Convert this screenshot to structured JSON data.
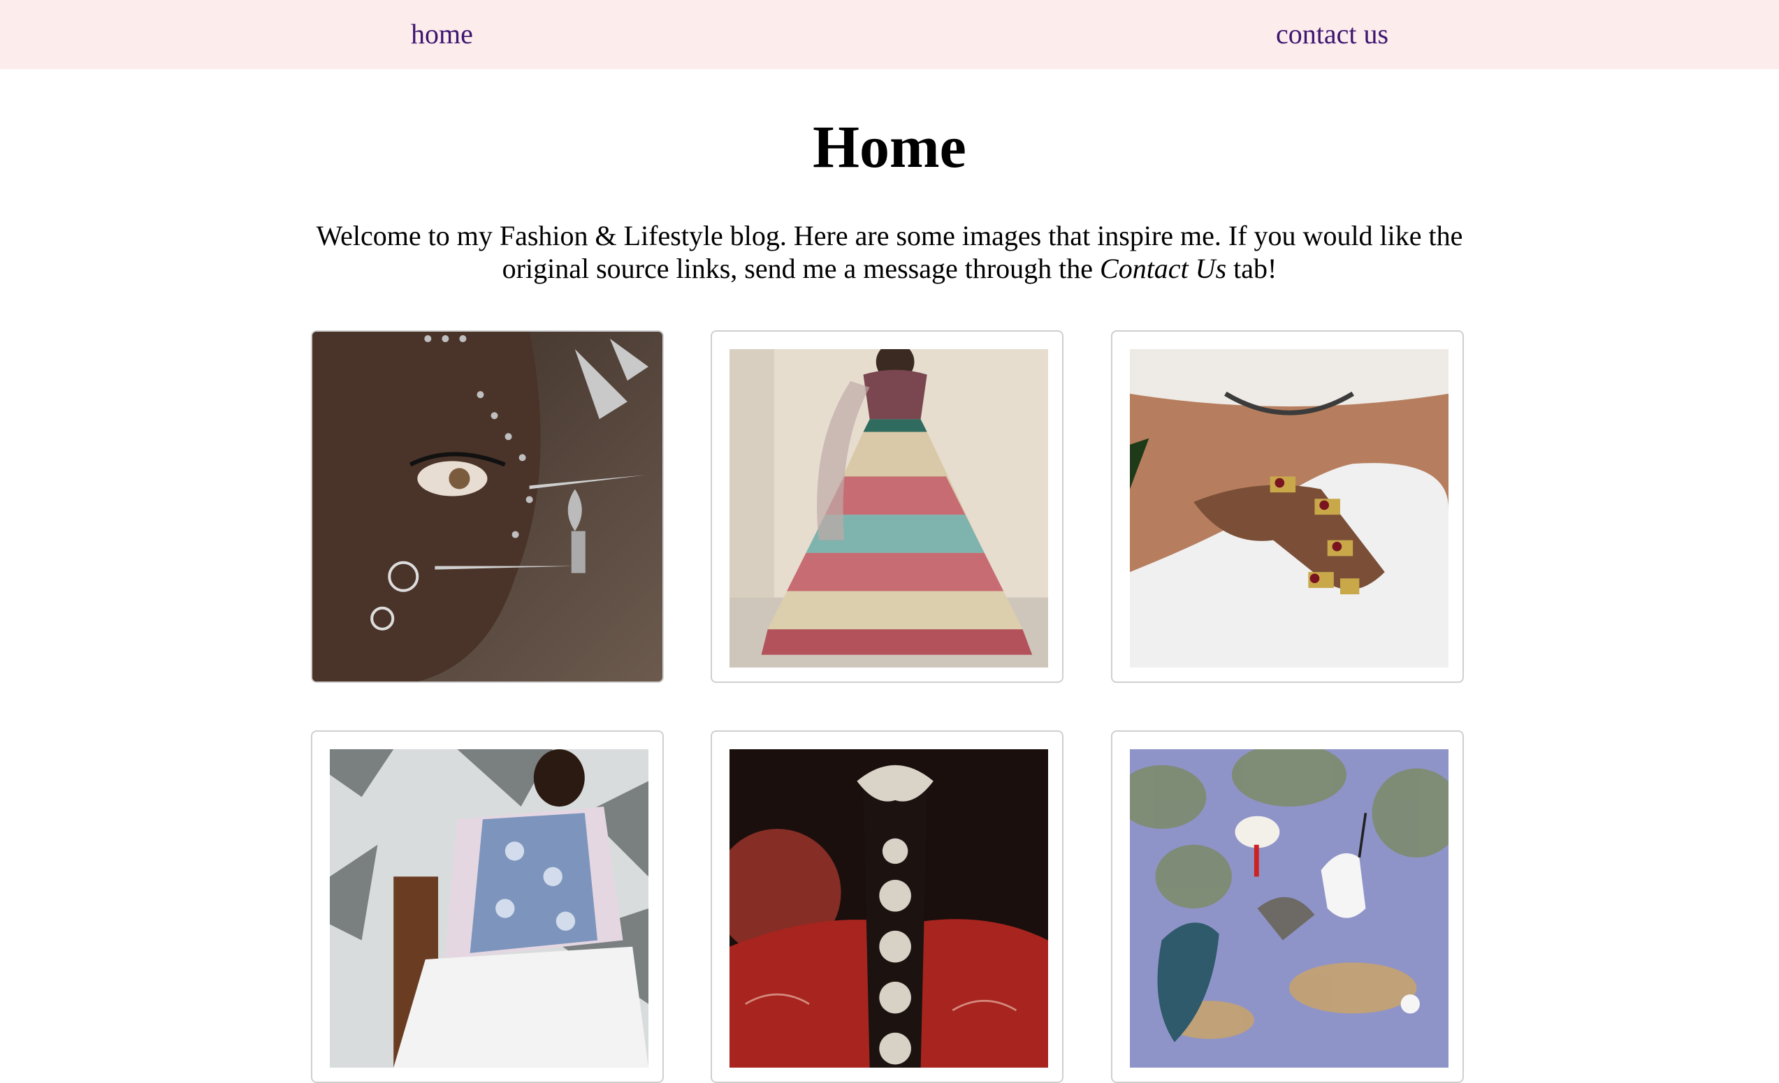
{
  "nav": {
    "home_label": "home",
    "contact_label": "contact us",
    "link_color": "#3d1670",
    "background": "#fcecec"
  },
  "main": {
    "title": "Home",
    "intro_before": "Welcome to my Fashion & Lifestyle blog. Here are some images that inspire me. If you would like the original source links, send me a message through the ",
    "intro_emphasis": "Contact Us",
    "intro_after": " tab!"
  },
  "gallery": {
    "items": [
      {
        "icon": "portrait-with-jewelry-image"
      },
      {
        "icon": "lehenga-bridal-outfit-image"
      },
      {
        "icon": "ring-jewelry-hand-image"
      },
      {
        "icon": "man-in-floral-jacket-image"
      },
      {
        "icon": "hair-jewelry-back-view-image"
      },
      {
        "icon": "mughal-painting-birds-image"
      }
    ]
  }
}
